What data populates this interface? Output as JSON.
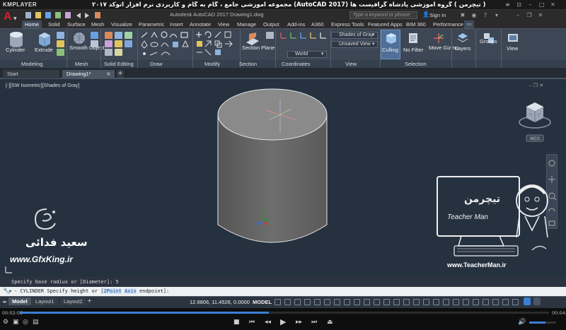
{
  "player": {
    "logo": "KMPLAYER",
    "title": "مجموعه آموزشی جامع ، گام به گام و کاربردی نرم افزار  اتوکد ۲۰۱۷ (AutoCAD 2017)  مدرس : سعید فدائی ( تیچرمن ) گروه آموزشی پادشاه گرافیست ها",
    "time_elapsed": "00:02:05",
    "time_total": "00:04:23",
    "progress": 0.47,
    "volume": 0.6
  },
  "acad": {
    "doc_title": "Autodesk AutoCAD 2017    Drawing1.dwg",
    "search_placeholder": "Type a keyword or phrase",
    "sign_in": "Sign In"
  },
  "ribbon": {
    "tabs": [
      "Home",
      "Solid",
      "Surface",
      "Mesh",
      "Visualize",
      "Parametric",
      "Insert",
      "Annotate",
      "View",
      "Manage",
      "Output",
      "Add-ins",
      "A360",
      "Express Tools",
      "Featured Apps",
      "BIM 360",
      "Performance"
    ],
    "active_tab": "Home",
    "groups": [
      "Modeling",
      "Mesh",
      "Solid Editing",
      "Draw",
      "Modify",
      "Section",
      "Coordinates",
      "View",
      "Selection"
    ],
    "buttons": {
      "cylinder": "Cylinder",
      "extrude": "Extrude",
      "smooth_object": "Smooth Object",
      "section_plane": "Section Plane",
      "culling": "Culling",
      "no_filter": "No Filter",
      "move_gizmo": "Move Gizmo",
      "layers": "Layers",
      "groups": "Groups",
      "view": "View"
    },
    "combos": {
      "visual_style": "Shades of Gray",
      "view_preset": "Unsaved View",
      "ucs": "World"
    }
  },
  "doc_tabs": {
    "start": "Start",
    "drawing": "Drawing1*"
  },
  "viewport": {
    "label": "[-][SW Isometric][Shades of Gray]",
    "wcs": "WCS"
  },
  "watermark": {
    "left_name": "سعید فدائی",
    "left_url": "www.GfxKing.ir",
    "badge_title": "تیچرمن",
    "badge_subtitle": "Teacher Man",
    "right_url": "www.TeacherMan.ir"
  },
  "command": {
    "history": "Specify base radius or [Diameter]: 5",
    "prompt_prefix": "- CYLINDER Specify height or [",
    "opt1": "2Point",
    "opt2": "Axis",
    "opt3": "endpoint",
    "prompt_suffix": "]:"
  },
  "status": {
    "layout_tabs": [
      "Model",
      "Layout1",
      "Layout2"
    ],
    "coords": "12.9806, 11.4526, 0.0000",
    "space": "MODEL"
  },
  "colors": {
    "accent": "#3a7fd5",
    "ribbon_bg": "#3c4654",
    "viewport_bg": "#263140",
    "cylinder": "#6b6b6b"
  }
}
